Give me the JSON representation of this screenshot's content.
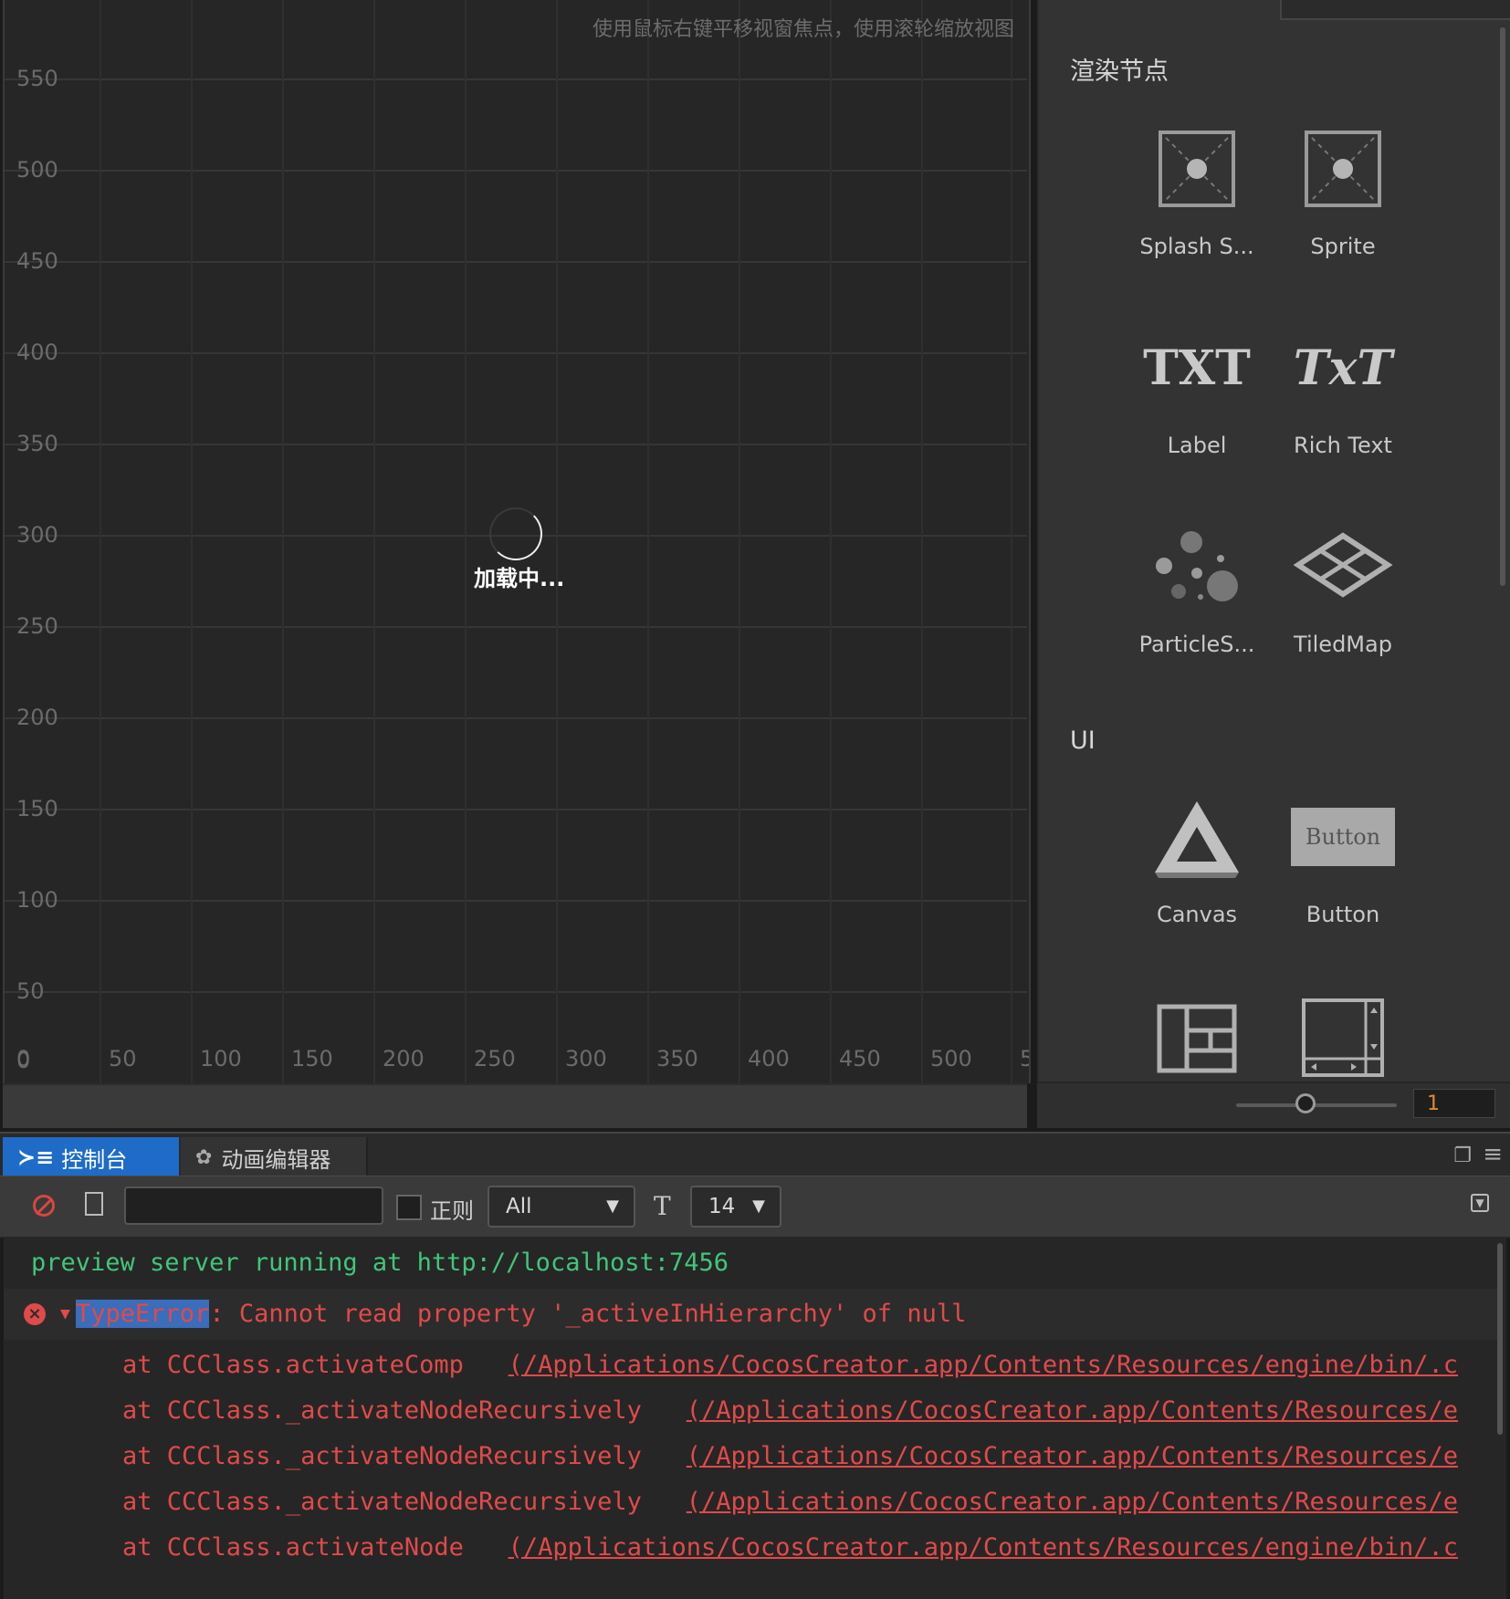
{
  "scene": {
    "hint": "使用鼠标右键平移视窗焦点，使用滚轮缩放视图",
    "y_ticks": [
      "550",
      "500",
      "450",
      "400",
      "350",
      "300",
      "250",
      "200",
      "150",
      "100",
      "50",
      "0"
    ],
    "x_ticks": [
      "0",
      "50",
      "100",
      "150",
      "200",
      "250",
      "300",
      "350",
      "400",
      "450",
      "500",
      "5"
    ],
    "loading": "加载中..."
  },
  "library": {
    "sections": [
      {
        "title": "渲染节点",
        "items": [
          "Splash S...",
          "Sprite",
          "Label",
          "Rich Text",
          "ParticleS...",
          "TiledMap"
        ]
      },
      {
        "title": "UI",
        "items": [
          "Canvas",
          "Button"
        ]
      }
    ],
    "icons": {
      "label_icon_text": "TXT",
      "richtext_icon_text": "TxT",
      "button_icon_text": "Button"
    },
    "zoom_value": "1"
  },
  "console": {
    "tabs": [
      "控制台",
      "动画编辑器"
    ],
    "regex_label": "正则",
    "level": "All",
    "font_size": "14",
    "search_value": "",
    "logs": {
      "info": "preview server running at http://localhost:7456",
      "error_type": "TypeError",
      "error_message": ": Cannot read property '_activeInHierarchy' of null",
      "trace": [
        {
          "fn": "at CCClass.activateComp",
          "loc": "(/Applications/CocosCreator.app/Contents/Resources/engine/bin/.c"
        },
        {
          "fn": "at CCClass._activateNodeRecursively",
          "loc": "(/Applications/CocosCreator.app/Contents/Resources/e"
        },
        {
          "fn": "at CCClass._activateNodeRecursively",
          "loc": "(/Applications/CocosCreator.app/Contents/Resources/e"
        },
        {
          "fn": "at CCClass._activateNodeRecursively",
          "loc": "(/Applications/CocosCreator.app/Contents/Resources/e"
        },
        {
          "fn": "at CCClass.activateNode",
          "loc": "(/Applications/CocosCreator.app/Contents/Resources/engine/bin/.c"
        }
      ]
    }
  },
  "colors": {
    "accent_tab": "#1e6cc8",
    "info_text": "#43c57a",
    "error_text": "#e04a4a",
    "zoom_value": "#e08a2c"
  }
}
